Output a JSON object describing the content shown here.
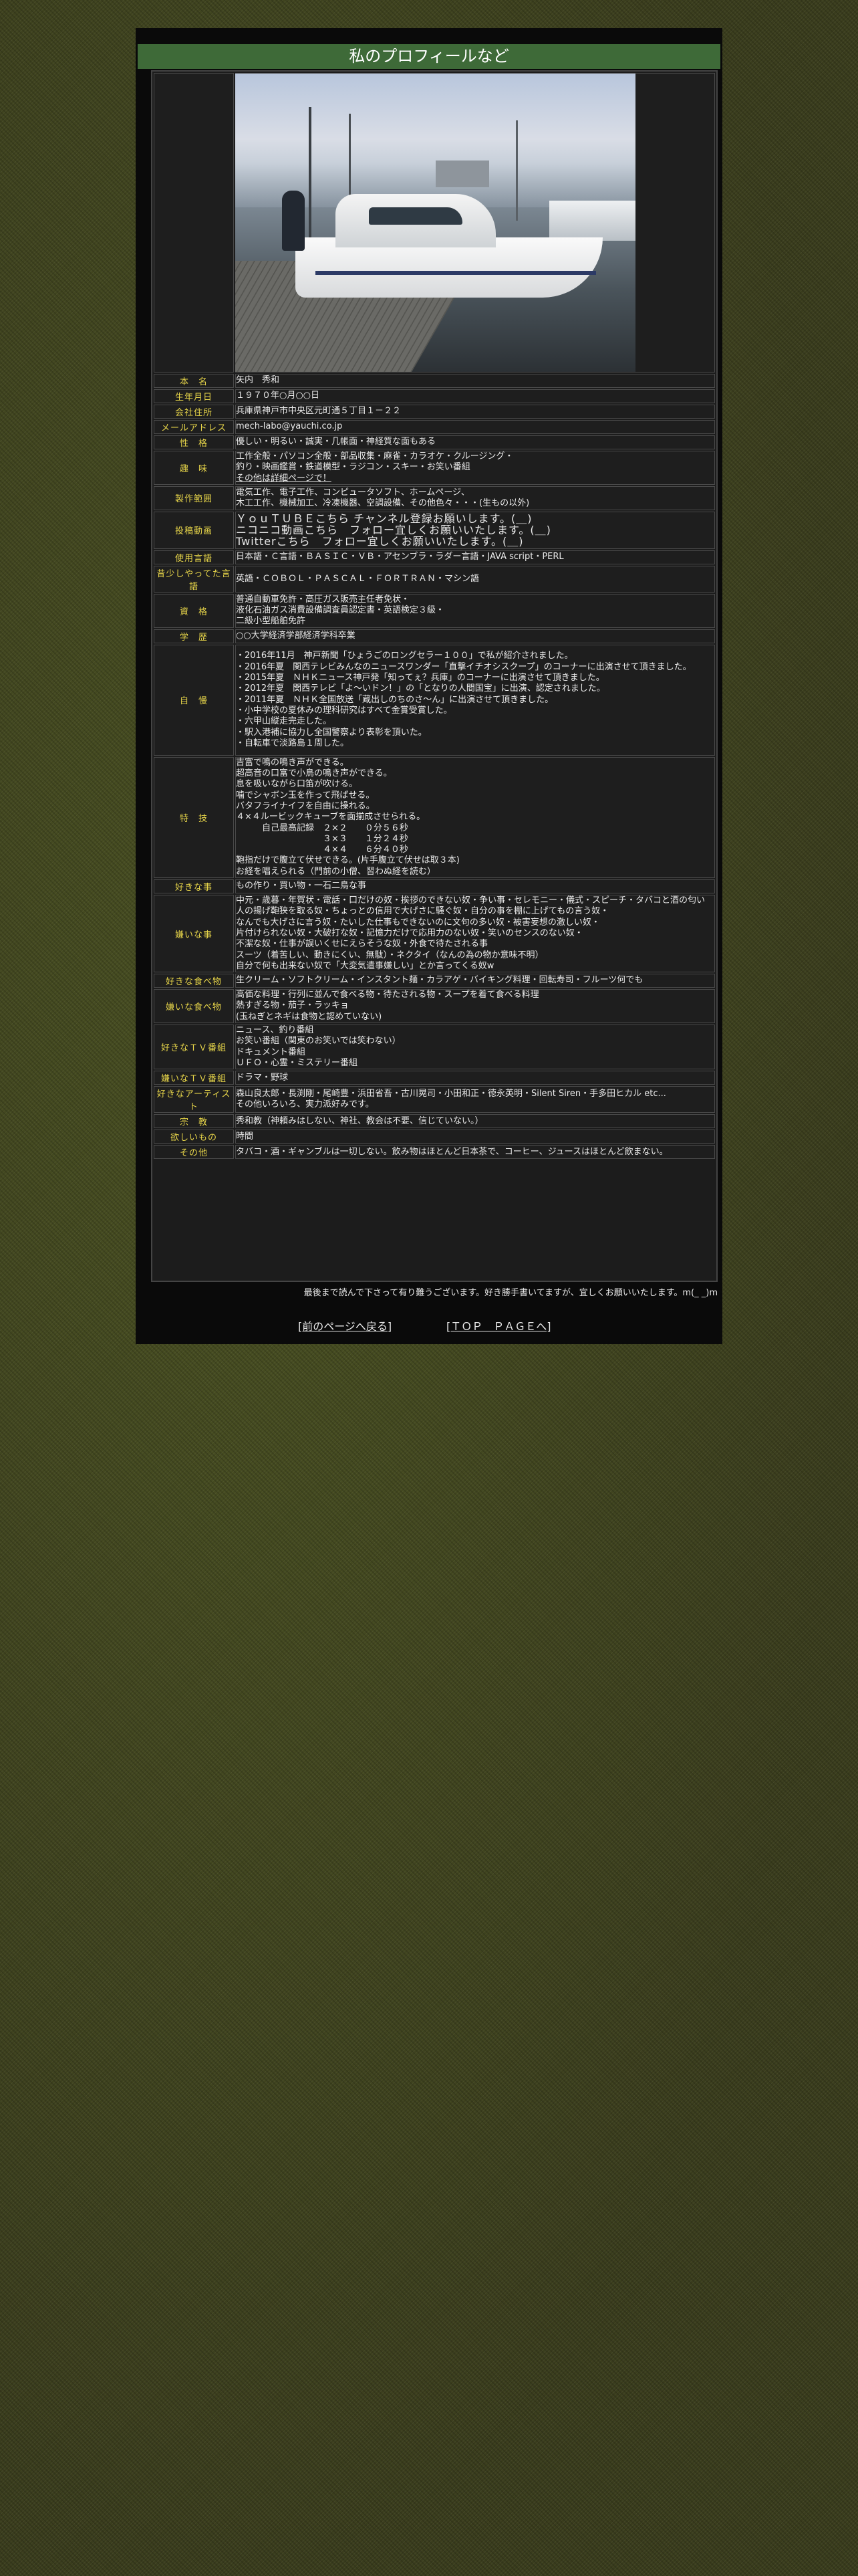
{
  "title": "私のプロフィールなど",
  "photo_alt": "ボートと人物の写真",
  "rows": [
    {
      "label": "本　名",
      "lines": [
        "矢内　秀和"
      ]
    },
    {
      "label": "生年月日",
      "lines": [
        "１９７０年○月○○日"
      ]
    },
    {
      "label": "会社住所",
      "lines": [
        "兵庫県神戸市中央区元町通５丁目１－２２"
      ]
    },
    {
      "label": "メールアドレス",
      "lines": [
        "mech-labo@yauchi.co.jp"
      ]
    },
    {
      "label": "性　格",
      "lines": [
        "優しい・明るい・誠実・几帳面・神経質な面もある"
      ]
    },
    {
      "label": "趣　味",
      "lines": [
        "工作全般・パソコン全般・部品収集・麻雀・カラオケ・クルージング・",
        "釣り・映画鑑賞・鉄道模型・ラジコン・スキー・お笑い番組",
        "その他は詳細ページで！"
      ],
      "link_index": 2
    },
    {
      "label": "製作範囲",
      "lines": [
        "電気工作、電子工作、コンピュータソフト、ホームページ、",
        "木工工作、機械加工、冷凍機器、空調設備、その他色々・・・(生もの以外)"
      ]
    },
    {
      "label": "投稿動画",
      "lines": [
        "ＹｏｕＴＵＢＥこちら チャンネル登録お願いします。(＿)",
        "ニコニコ動画こちら　フォロー宜しくお願いいたします。(＿)",
        "Twitterこちら　フォロー宜しくお願いいたします。(＿)"
      ],
      "big": true
    },
    {
      "label": "使用言語",
      "lines": [
        "日本語・Ｃ言語・ＢＡＳＩＣ・ＶＢ・アセンブラ・ラダー言語・JAVA script・PERL"
      ]
    },
    {
      "label": "昔少しやってた言語",
      "lines": [
        "英語・ＣＯＢＯＬ・ＰＡＳＣＡＬ・ＦＯＲＴＲＡＮ・マシン語"
      ]
    },
    {
      "label": "資　格",
      "lines": [
        "普通自動車免許・高圧ガス販売主任者免状・",
        "液化石油ガス消費設備調査員認定書・英語検定３級・",
        "二級小型船舶免許"
      ]
    },
    {
      "label": "学　歴",
      "lines": [
        "○○大学経済学部経済学科卒業"
      ]
    },
    {
      "label": "自　慢",
      "lines": [
        "・2016年11月　神戸新聞「ひょうごのロングセラー１００」で私が紹介されました。",
        "・2016年夏　関西テレビみんなのニュースワンダー「直撃イチオシスクープ」のコーナーに出演させて頂きました。",
        "・2015年夏　ＮＨＫニュース神戸発「知ってぇ？兵庫」のコーナーに出演させて頂きました。",
        "・2012年夏　関西テレビ「よ～いドン！」の「となりの人間国宝」に出演、認定されました。",
        "・2011年夏　ＮＨＫ全国放送「蔵出しのちのさ～ん」に出演させて頂きました。",
        "・小中学校の夏休みの理科研究はすべて金賞受賞した。",
        "・六甲山縦走完走した。",
        "・駅入港補に協力し全国警察より表彰を頂いた。",
        "・自転車で淡路島１周した。"
      ]
    },
    {
      "label": "特　技",
      "lines": [
        "吉富で鳴の鳴き声ができる。",
        "超高音の口富で小鳥の鳴き声ができる。",
        "息を吸いながら口笛が吹ける。",
        "噛でシャボン玉を作って飛ばせる。",
        "バタフライナイフを自由に操れる。",
        "４×４ルービックキューブを面揃成させられる。",
        "　　　自己最高記録　２×２　　０分５６秒",
        "　　　　　　　　　　３×３　　１分２４秒",
        "　　　　　　　　　　４×４　　６分４０秒",
        "鞄指だけで腹立て伏せできる。(片手腹立て伏せは取３本)",
        "お経を唱えられる（門前の小僧、習わぬ経を読む）"
      ]
    },
    {
      "label": "好きな事",
      "lines": [
        "もの作り・買い物・一石二鳥な事"
      ]
    },
    {
      "label": "嫌いな事",
      "lines": [
        "中元・歳暮・年賀状・電話・口だけの奴・挨拶のできない奴・争い事・セレモニー・儀式・スピーチ・タバコと酒の匂い",
        "人の揚げ鞄狭を取る奴・ちょっとの信用で大げさに騒ぐ奴・自分の事を棚に上げてもの言う奴・",
        "なんでも大げさに言う奴・たいした仕事もできないのに文句の多い奴・被害妄想の激しい奴・",
        "片付けられない奴・大破打な奴・記憶力だけで応用力のない奴・笑いのセンスのない奴・",
        "不潔な奴・仕事が誤いくせにえらそうな奴・外食で待たされる事",
        "スーツ（着苦しい、動きにくい、無駄）・ネクタイ（なんの為の物か意味不明）",
        "自分で何も出来ない奴で「大変気遣事嫌しい」とか言ってくる奴w"
      ]
    },
    {
      "label": "好きな食べ物",
      "lines": [
        "生クリーム・ソフトクリーム・インスタント麺・カラアゲ・バイキング料理・回転寿司・フルーツ何でも"
      ]
    },
    {
      "label": "嫌いな食べ物",
      "lines": [
        "高価な料理・行列に並んで食べる物・待たされる物・スープを着て食べる料理",
        "熱すぎる物・茄子・ラッキョ",
        "(玉ねぎとネギは食物と認めていない)"
      ]
    },
    {
      "label": "好きなＴＶ番組",
      "lines": [
        "ニュース、釣り番組",
        "お笑い番組（関東のお笑いでは笑わない）",
        "ドキュメント番組",
        "ＵＦＯ・心霊・ミステリー番組"
      ]
    },
    {
      "label": "嫌いなＴＶ番組",
      "lines": [
        "ドラマ・野球"
      ]
    },
    {
      "label": "好きなアーティスト",
      "lines": [
        "森山良太郎・長渕剛・尾崎豊・浜田省吾・古川晃司・小田和正・徳永英明・Silent Siren・手多田ヒカル etc...",
        "その他いろいろ、実力派好みです。"
      ]
    },
    {
      "label": "宗　教",
      "lines": [
        "秀和教（神頼みはしない、神社、教会は不要、信じていない。）"
      ]
    },
    {
      "label": "欲しいもの",
      "lines": [
        "時間"
      ]
    },
    {
      "label": "その他",
      "lines": [
        "タバコ・酒・ギャンブルは一切しない。飲み物はほとんど日本茶で、コーヒー、ジュースはほとんど飲まない。"
      ]
    }
  ],
  "footer_note": "最後まで読んで下さって有り難うございます。好き勝手書いてますが、宜しくお願いいたします。m(_ _)m",
  "nav": {
    "back": "[前のページへ戻る]",
    "top": "[ＴＯＰ　ＰＡＧＥへ]"
  }
}
